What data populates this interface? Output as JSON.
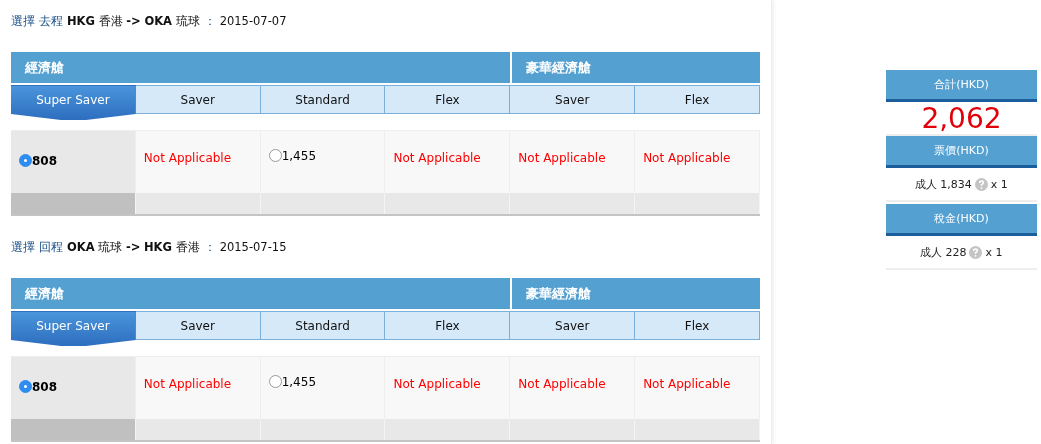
{
  "legs": [
    {
      "heading": {
        "action": "選擇",
        "direction": "去程",
        "route": "**HKG** 香港 **->** **OKA** 琉球",
        "separator": "：",
        "date": "2015-07-07"
      },
      "groups": [
        {
          "label": "經濟艙"
        },
        {
          "label": "豪華經濟艙"
        }
      ],
      "fare_tabs": [
        {
          "label": "Super Saver",
          "selected": true
        },
        {
          "label": "Saver",
          "selected": false
        },
        {
          "label": "Standard",
          "selected": false
        },
        {
          "label": "Flex",
          "selected": false
        },
        {
          "label": "Saver",
          "selected": false
        },
        {
          "label": "Flex",
          "selected": false
        }
      ],
      "cells": [
        {
          "kind": "fare",
          "price": "808",
          "selected": true
        },
        {
          "kind": "na",
          "text": "Not Applicable"
        },
        {
          "kind": "fare",
          "price": "1,455",
          "selected": false
        },
        {
          "kind": "na",
          "text": "Not Applicable"
        },
        {
          "kind": "na",
          "text": "Not Applicable"
        },
        {
          "kind": "na",
          "text": "Not Applicable"
        }
      ]
    },
    {
      "heading": {
        "action": "選擇",
        "direction": "回程",
        "route": "**OKA** 琉球 **->** **HKG** 香港",
        "separator": "：",
        "date": "2015-07-15"
      },
      "groups": [
        {
          "label": "經濟艙"
        },
        {
          "label": "豪華經濟艙"
        }
      ],
      "fare_tabs": [
        {
          "label": "Super Saver",
          "selected": true
        },
        {
          "label": "Saver",
          "selected": false
        },
        {
          "label": "Standard",
          "selected": false
        },
        {
          "label": "Flex",
          "selected": false
        },
        {
          "label": "Saver",
          "selected": false
        },
        {
          "label": "Flex",
          "selected": false
        }
      ],
      "cells": [
        {
          "kind": "fare",
          "price": "808",
          "selected": true
        },
        {
          "kind": "na",
          "text": "Not Applicable"
        },
        {
          "kind": "fare",
          "price": "1,455",
          "selected": false
        },
        {
          "kind": "na",
          "text": "Not Applicable"
        },
        {
          "kind": "na",
          "text": "Not Applicable"
        },
        {
          "kind": "na",
          "text": "Not Applicable"
        }
      ]
    }
  ],
  "summary": [
    {
      "kind": "total",
      "title": "合計(HKD)",
      "value": "2,062"
    },
    {
      "kind": "breakdown",
      "title": "票價(HKD)",
      "passenger": "成人",
      "amount": "1,834",
      "quantity": "x 1"
    },
    {
      "kind": "breakdown",
      "title": "稅金(HKD)",
      "passenger": "成人",
      "amount": "228",
      "quantity": "x 1"
    }
  ]
}
